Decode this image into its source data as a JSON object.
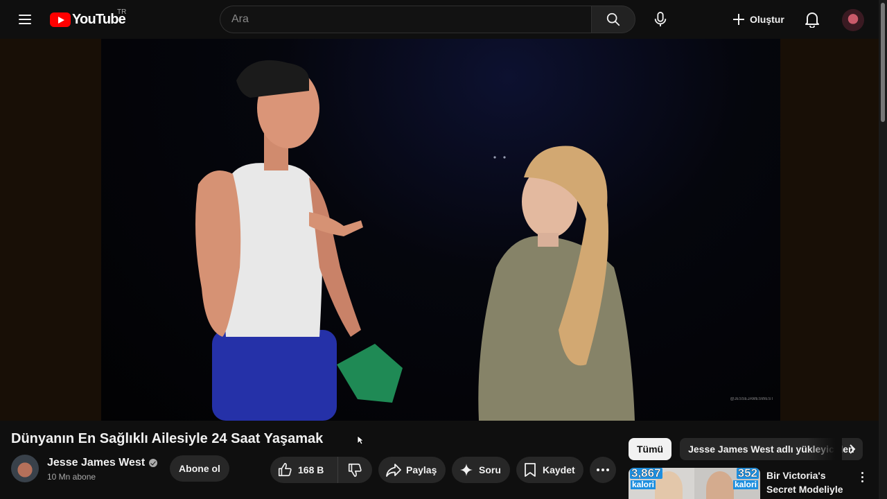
{
  "header": {
    "logo_text": "YouTube",
    "country_code": "TR",
    "search_placeholder": "Ara",
    "create_label": "Oluştur"
  },
  "video": {
    "title": "Dünyanın En Sağlıklı Ailesiyle 24 Saat Yaşamak",
    "watermark": "@JESSEJAMESWEST"
  },
  "channel": {
    "name": "Jesse James West",
    "subscribers": "10 Mn abone",
    "subscribe_label": "Abone ol"
  },
  "actions": {
    "like_count": "168 B",
    "share_label": "Paylaş",
    "ask_label": "Soru",
    "save_label": "Kaydet"
  },
  "sidebar": {
    "chips": [
      {
        "label": "Tümü",
        "active": true
      },
      {
        "label": "Jesse James West adlı yükleyiciden",
        "active": false
      }
    ],
    "recommendation": {
      "title": "Bir Victoria's Secret Modeliyle Diyetim...",
      "thumb_left_number": "3,867",
      "thumb_left_unit": "kalori",
      "thumb_right_number": "352",
      "thumb_right_unit": "kalori"
    }
  },
  "colors": {
    "background": "#0f0f0f",
    "button_bg": "#272727",
    "brand_red": "#ff0000",
    "secondary_text": "#aaaaaa"
  },
  "icons": [
    "menu-icon",
    "youtube-logo-icon",
    "search-icon",
    "microphone-icon",
    "plus-icon",
    "bell-icon",
    "thumb-up-icon",
    "thumb-down-icon",
    "share-icon",
    "sparkle-icon",
    "bookmark-icon",
    "more-horizontal-icon",
    "chevron-right-icon",
    "more-vertical-icon",
    "verified-icon"
  ]
}
